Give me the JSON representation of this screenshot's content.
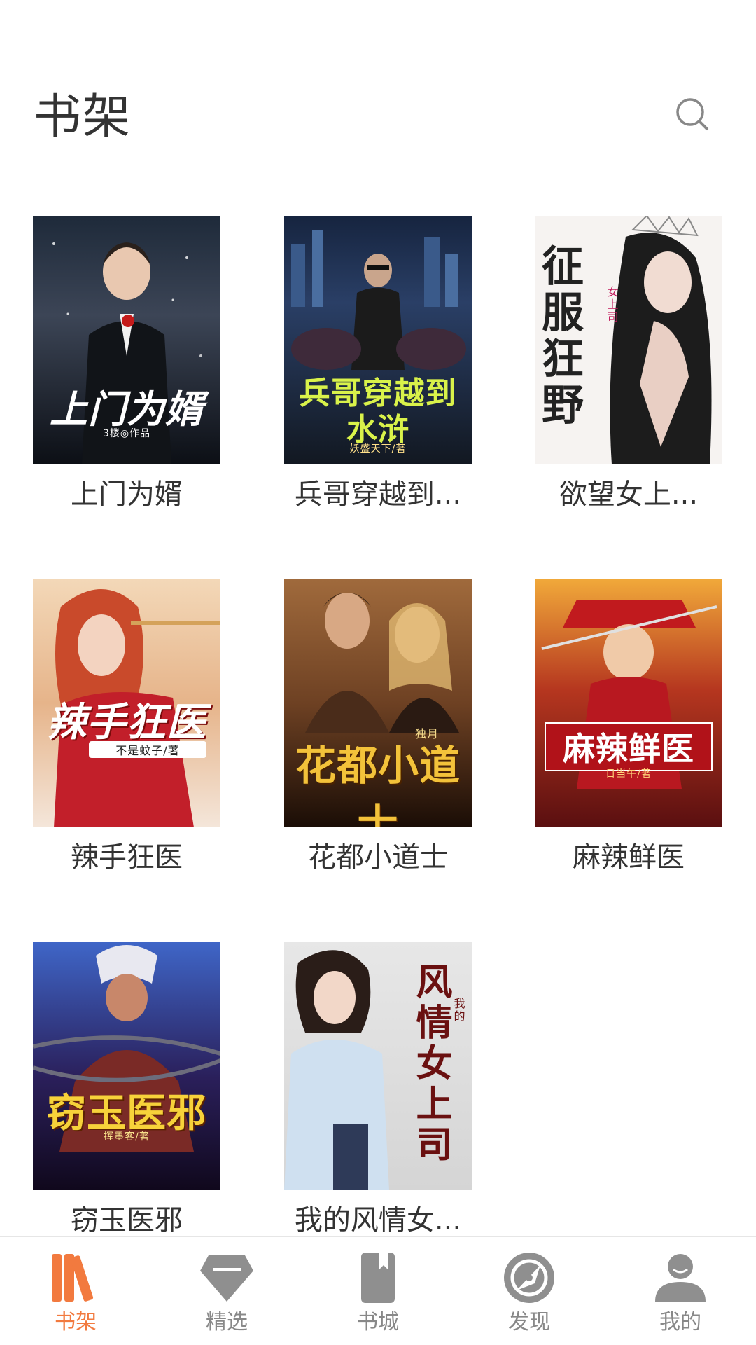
{
  "header": {
    "title": "书架",
    "search_icon": "search-icon"
  },
  "books": [
    {
      "name": "上门为婿",
      "cover_title": "上门为婿",
      "cover_sub": "3楼◎作品"
    },
    {
      "name": "兵哥穿越到...",
      "cover_title": "兵哥穿越到水浒",
      "cover_sub": "妖盛天下/著"
    },
    {
      "name": "欲望女上...",
      "cover_title": "征服狂野",
      "cover_sub": "女上司"
    },
    {
      "name": "辣手狂医",
      "cover_title": "辣手狂医",
      "cover_sub": "不是蚊子/著"
    },
    {
      "name": "花都小道士",
      "cover_title": "花都小道士",
      "cover_sub": "独月"
    },
    {
      "name": "麻辣鲜医",
      "cover_title": "麻辣鲜医",
      "cover_sub": "日当午/著"
    },
    {
      "name": "窃玉医邪",
      "cover_title": "窃玉医邪",
      "cover_sub": "挥墨客/著"
    },
    {
      "name": "我的风情女...",
      "cover_title": "风情女上司",
      "cover_sub": "我的"
    }
  ],
  "tabbar": {
    "items": [
      {
        "label": "书架",
        "icon": "bookshelf-icon",
        "active": true
      },
      {
        "label": "精选",
        "icon": "diamond-icon",
        "active": false
      },
      {
        "label": "书城",
        "icon": "book-icon",
        "active": false
      },
      {
        "label": "发现",
        "icon": "compass-icon",
        "active": false
      },
      {
        "label": "我的",
        "icon": "profile-icon",
        "active": false
      }
    ]
  },
  "colors": {
    "accent": "#f27a3f",
    "inactive": "#888888",
    "title": "#333333"
  }
}
